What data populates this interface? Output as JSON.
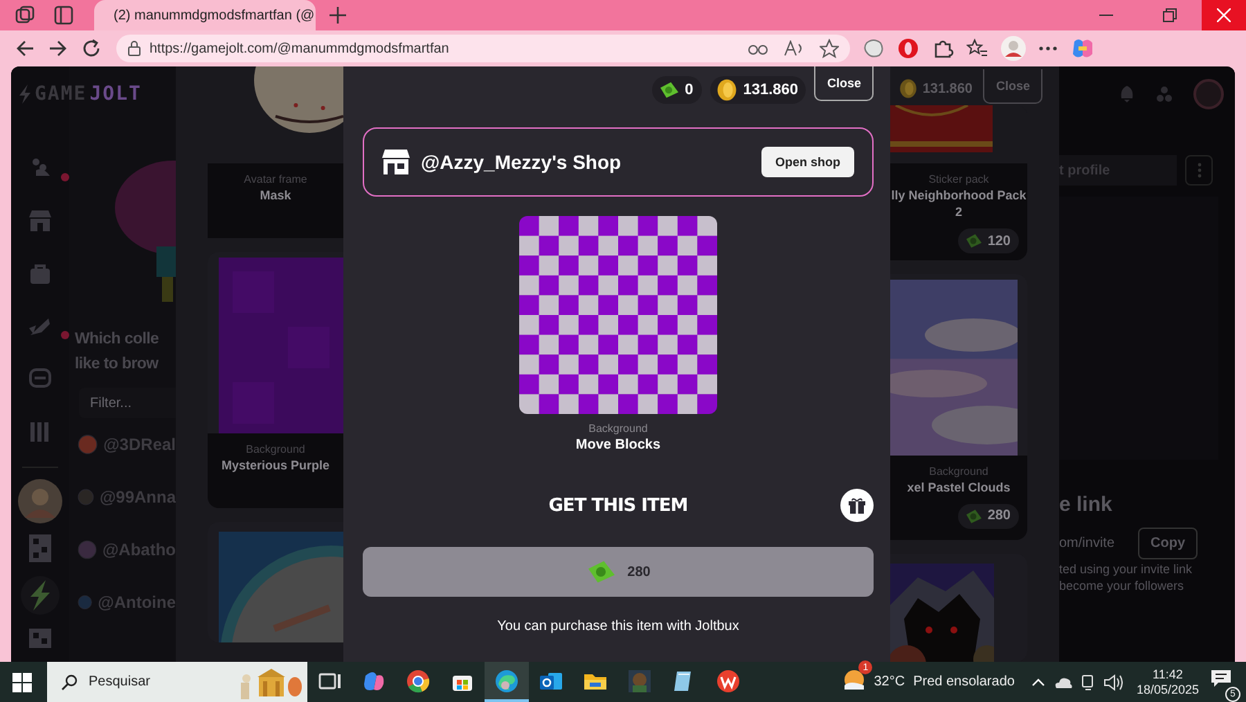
{
  "browser": {
    "tabs": [
      {
        "title": "(2) manummdgmodsfmartfan (@",
        "selected": true
      }
    ],
    "url": "https://gamejolt.com/@manummdgmodsfmartfan"
  },
  "site": {
    "logo": [
      "GAME",
      "JOLT"
    ]
  },
  "collections_panel": {
    "heading": [
      "Which colle",
      "like to brow"
    ],
    "filter_placeholder": "Filter...",
    "users": [
      "@3DReal",
      "@99Anna",
      "@Abatho",
      "@Antoine"
    ]
  },
  "profile_panel": {
    "field": "t profile",
    "invite_heading": "e link",
    "invite_url": "om/invite",
    "copy_button": "Copy",
    "invite_note": [
      "ted using your invite link",
      "become your followers"
    ]
  },
  "shop_modal": {
    "coins": "131.860",
    "close": "Close",
    "left_cards": [
      {
        "kind": "picture",
        "type": "Avatar frame",
        "name": [
          "Mask"
        ]
      },
      {
        "kind": "picture",
        "type": "Background",
        "name": [
          "Mysterious Purple"
        ]
      },
      {
        "kind": "picture"
      }
    ],
    "right_cards": [
      {
        "kind": "picture",
        "type": "Sticker pack",
        "name": [
          "lly Neighborhood Pack",
          "2"
        ],
        "price": "120"
      },
      {
        "kind": "picture",
        "type": "Background",
        "name": [
          "xel Pastel Clouds"
        ],
        "price": "280"
      },
      {
        "kind": "picture"
      }
    ]
  },
  "item_modal": {
    "joltbux": "0",
    "coins": "131.860",
    "close": "Close",
    "shop": {
      "name": "@Azzy_Mezzy's Shop",
      "button": "Open shop"
    },
    "item": {
      "type": "Background",
      "name": "Move Blocks"
    },
    "heading": "GET THIS ITEM",
    "price": "280",
    "note": "You can purchase this item with Joltbux"
  },
  "taskbar": {
    "search_placeholder": "Pesquisar",
    "apps": [
      {
        "kind": "taskview",
        "selected": false
      },
      {
        "kind": "copilot",
        "selected": false
      },
      {
        "kind": "chrome",
        "selected": false
      },
      {
        "kind": "store",
        "selected": false
      },
      {
        "kind": "edge",
        "selected": true
      },
      {
        "kind": "outlook",
        "selected": false
      },
      {
        "kind": "explorer",
        "selected": false
      },
      {
        "kind": "game",
        "selected": false
      },
      {
        "kind": "notes",
        "selected": false
      },
      {
        "kind": "wps",
        "selected": false
      }
    ],
    "weather": {
      "badge": "1",
      "temperature": "32°C",
      "condition": "Pred ensolarado"
    },
    "time": "11:42",
    "date": "18/05/2025",
    "notifications": "5"
  }
}
